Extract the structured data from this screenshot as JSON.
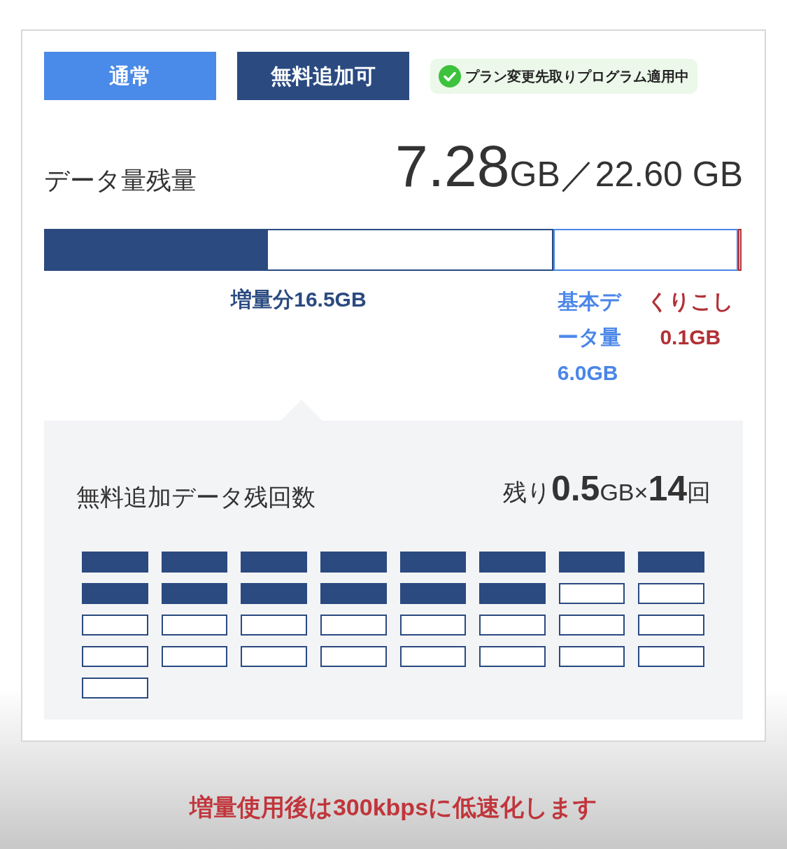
{
  "mode_buttons": [
    {
      "label": "通常",
      "selected": false
    },
    {
      "label": "無料追加可",
      "selected": true
    }
  ],
  "program_badge": {
    "label": "プラン変更先取りプログラム適用中",
    "active": true
  },
  "remaining": {
    "label": "データ量残量",
    "amount": "7.28",
    "unit": "GB",
    "separator": "／",
    "total": "22.60 GB"
  },
  "usage_bar": {
    "level": 0.44,
    "segments": [
      {
        "kind": "increase",
        "label": "増量分16.5GB"
      },
      {
        "kind": "basic",
        "label": "基本データ量6.0GB"
      },
      {
        "kind": "carryover",
        "label": "くりこし0.1GB"
      }
    ]
  },
  "free_add": {
    "label": "無料追加データ残回数",
    "count_parts": [
      {
        "text": "残り",
        "emphasis": false
      },
      {
        "text": "0.5",
        "emphasis": true
      },
      {
        "text": "GB×",
        "emphasis": false
      },
      {
        "text": "14",
        "emphasis": true
      },
      {
        "text": "回",
        "emphasis": false
      }
    ],
    "slots": [
      {
        "filled": true
      },
      {
        "filled": true
      },
      {
        "filled": true
      },
      {
        "filled": true
      },
      {
        "filled": true
      },
      {
        "filled": true
      },
      {
        "filled": true
      },
      {
        "filled": true
      },
      {
        "filled": true
      },
      {
        "filled": true
      },
      {
        "filled": true
      },
      {
        "filled": true
      },
      {
        "filled": true
      },
      {
        "filled": true
      },
      {
        "filled": false
      },
      {
        "filled": false
      },
      {
        "filled": false
      },
      {
        "filled": false
      },
      {
        "filled": false
      },
      {
        "filled": false
      },
      {
        "filled": false
      },
      {
        "filled": false
      },
      {
        "filled": false
      },
      {
        "filled": false
      },
      {
        "filled": false
      },
      {
        "filled": false
      },
      {
        "filled": false
      },
      {
        "filled": false
      },
      {
        "filled": false
      },
      {
        "filled": false
      },
      {
        "filled": false
      },
      {
        "filled": false
      },
      {
        "filled": false
      }
    ]
  },
  "notice": "増量使用後は300kbpsに低速化します"
}
